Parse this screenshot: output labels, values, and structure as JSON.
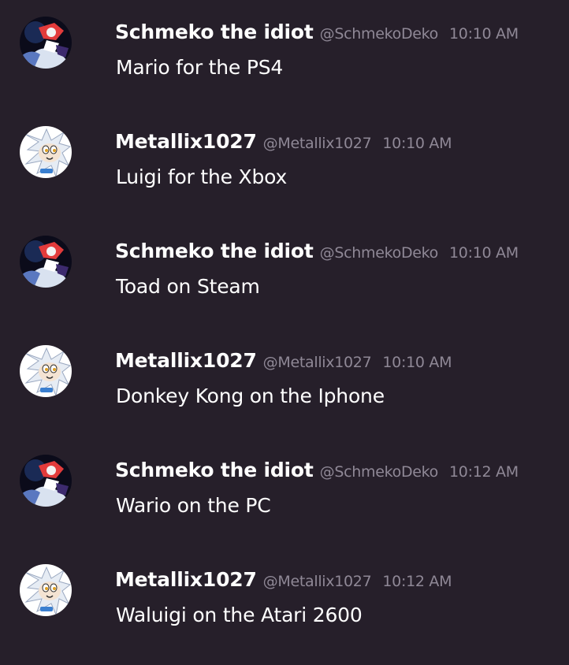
{
  "messages": [
    {
      "author": "Schmeko the idiot",
      "handle": "@SchmekoDeko",
      "time": "10:10 AM",
      "text": "Mario for the PS4",
      "avatar": "dark-knight-avatar-icon"
    },
    {
      "author": "Metallix1027",
      "handle": "@Metallix1027",
      "time": "10:10 AM",
      "text": "Luigi for the Xbox",
      "avatar": "silver-hedgehog-avatar-icon"
    },
    {
      "author": "Schmeko the idiot",
      "handle": "@SchmekoDeko",
      "time": "10:10 AM",
      "text": "Toad on Steam",
      "avatar": "dark-knight-avatar-icon"
    },
    {
      "author": "Metallix1027",
      "handle": "@Metallix1027",
      "time": "10:10 AM",
      "text": "Donkey Kong on the Iphone",
      "avatar": "silver-hedgehog-avatar-icon"
    },
    {
      "author": "Schmeko the idiot",
      "handle": "@SchmekoDeko",
      "time": "10:12 AM",
      "text": "Wario on the PC",
      "avatar": "dark-knight-avatar-icon"
    },
    {
      "author": "Metallix1027",
      "handle": "@Metallix1027",
      "time": "10:12 AM",
      "text": "Waluigi on the Atari 2600",
      "avatar": "silver-hedgehog-avatar-icon"
    }
  ],
  "colors": {
    "background": "#261f2a",
    "author": "#ffffff",
    "meta": "#8f8896",
    "text": "#ffffff"
  }
}
